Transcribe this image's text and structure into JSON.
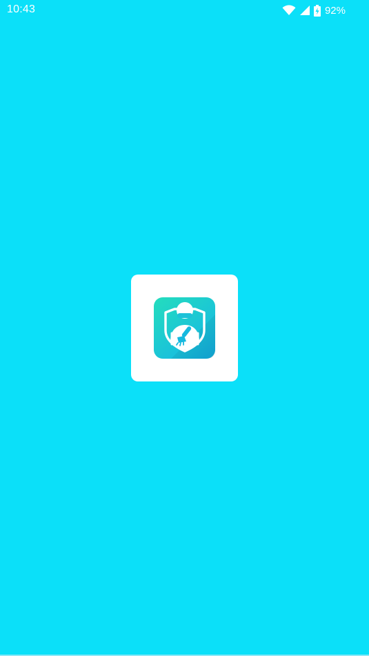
{
  "status_bar": {
    "time": "10:43",
    "battery_percent": "92%",
    "icons": [
      "wifi-icon",
      "cellular-signal-icon",
      "battery-icon"
    ]
  },
  "splash": {
    "app_icon": "shield-cleaner-app-icon"
  },
  "colors": {
    "background": "#0be0f9",
    "card": "#ffffff",
    "icon_gradient_top": "#20dcc2",
    "icon_gradient_bottom": "#17b8e2"
  }
}
